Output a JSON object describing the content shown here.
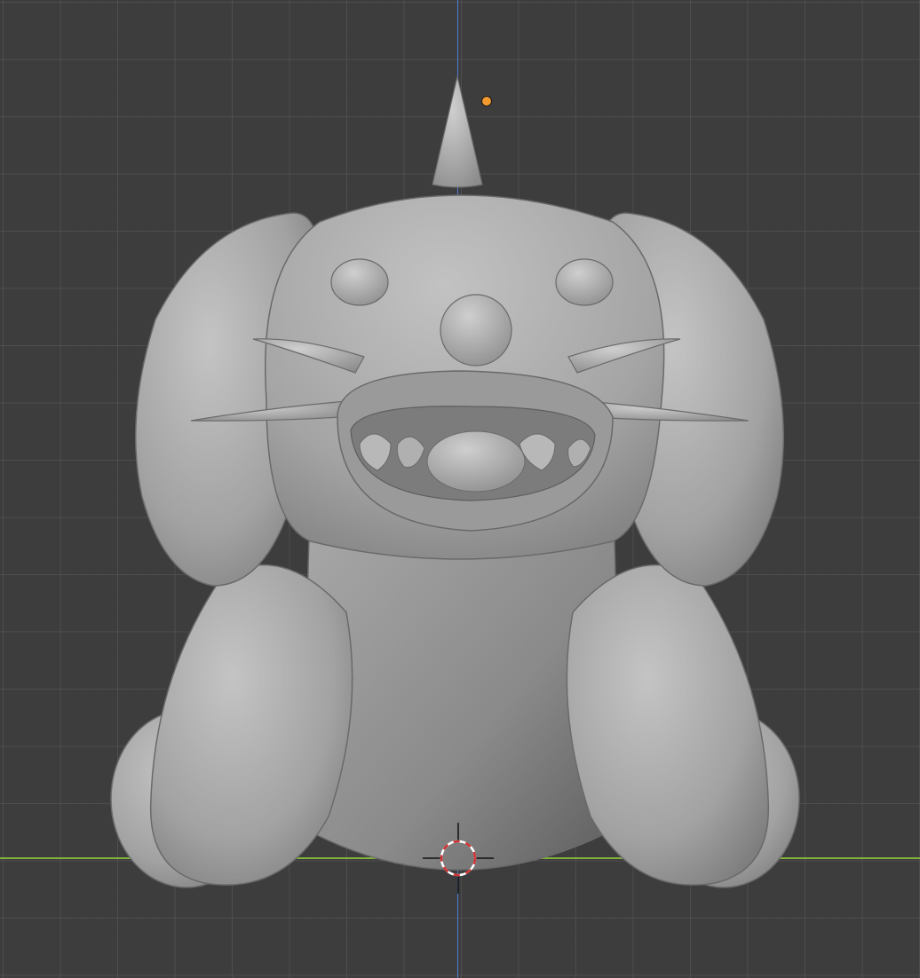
{
  "viewport": {
    "background_color": "#3d3d3d",
    "grid_color": "#5a5a5a",
    "axis_x_color": "#7fb23b",
    "axis_z_color": "#4f7fd6",
    "origin_color": "#f29a2e",
    "mesh_color": "#a8a8a8"
  },
  "objects": {
    "model_icon": "monster-character-mesh",
    "origin_icon": "object-origin-dot",
    "cursor_icon": "3d-cursor-icon"
  }
}
